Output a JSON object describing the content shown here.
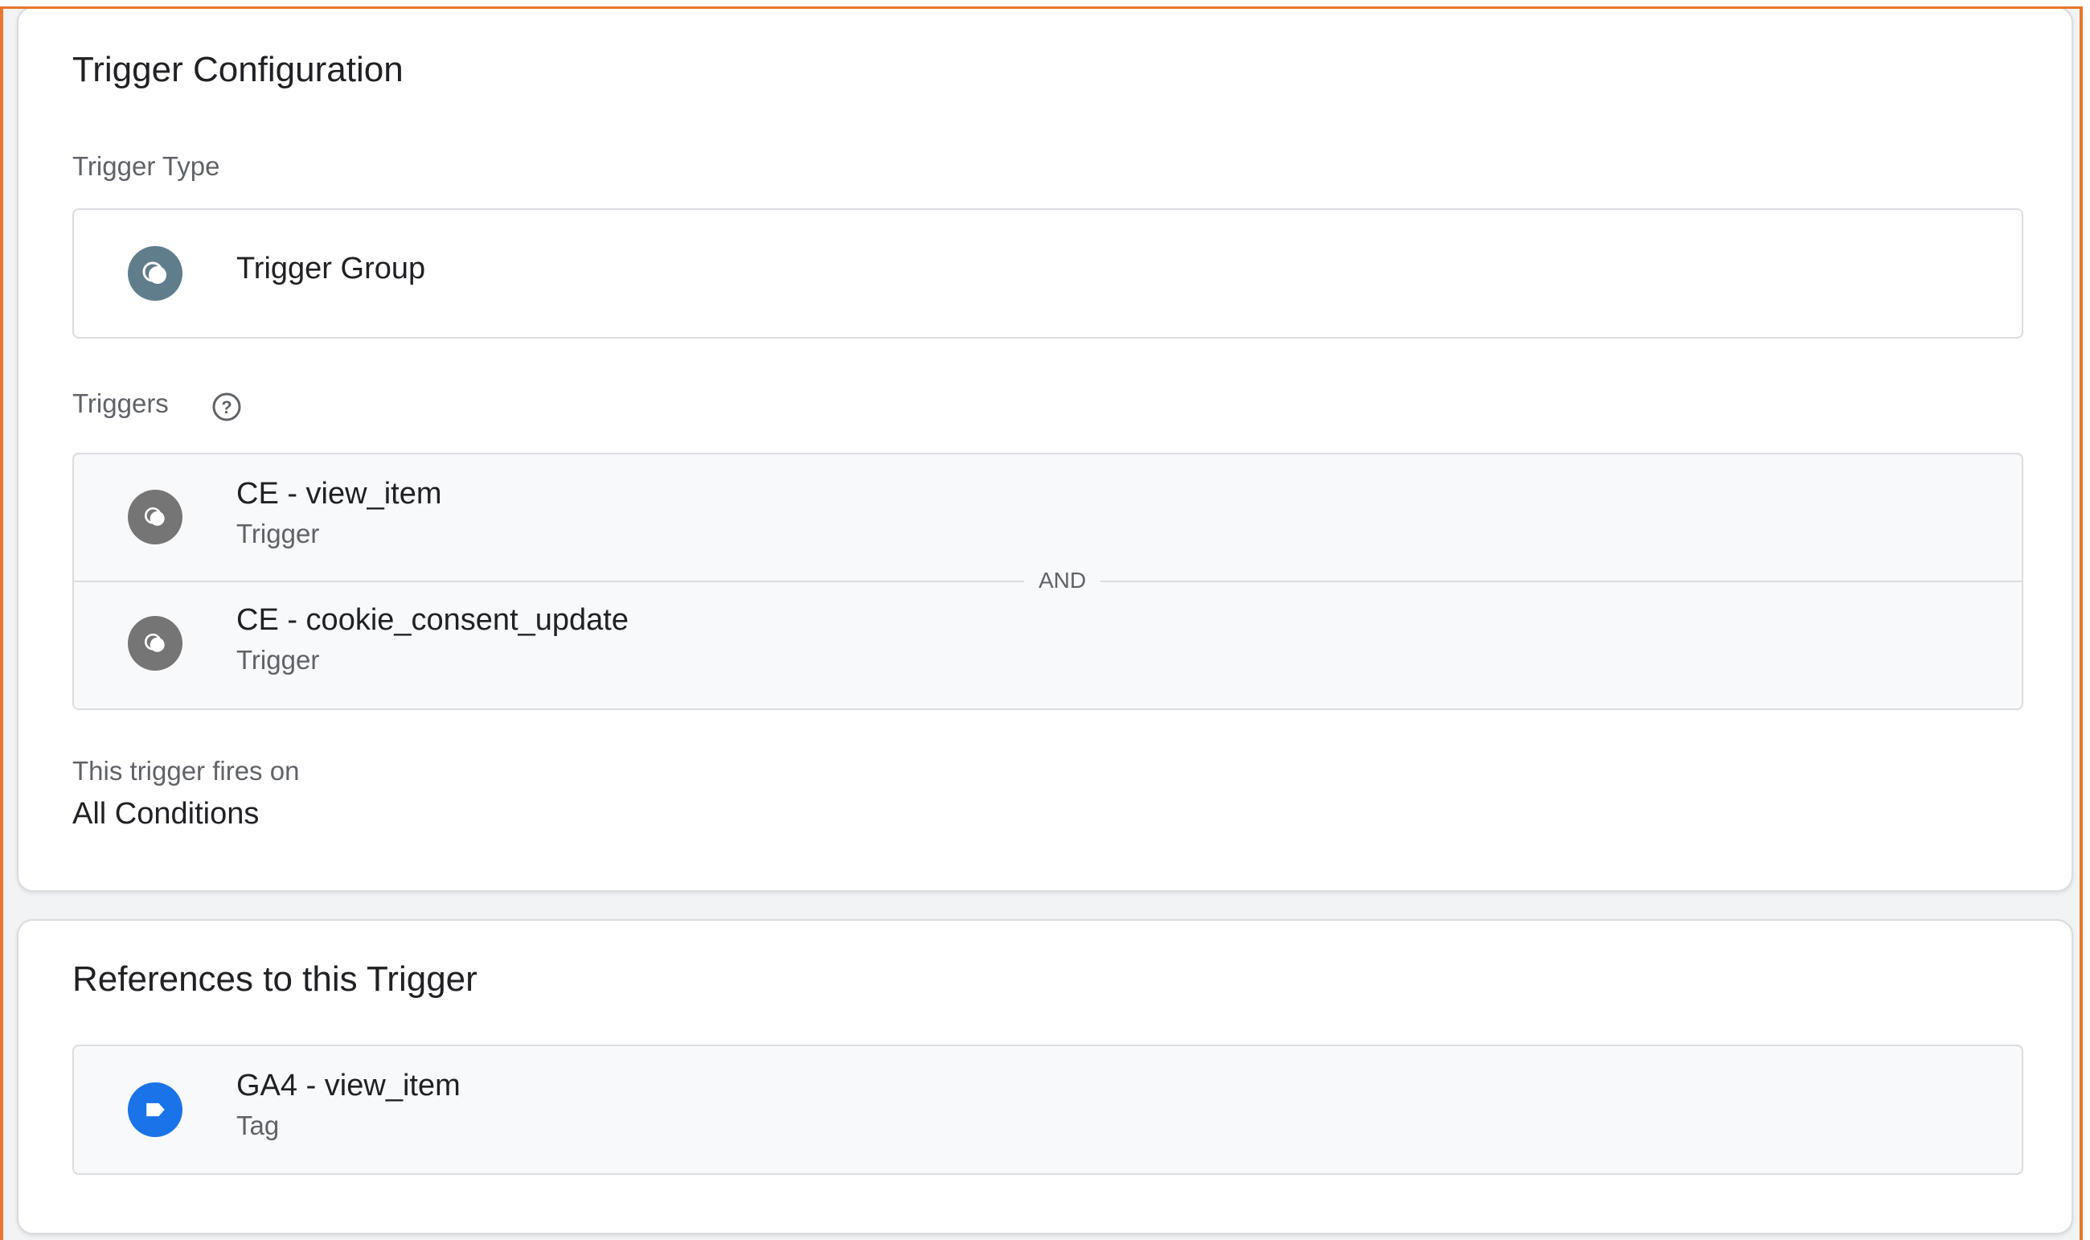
{
  "trigger_configuration": {
    "title": "Trigger Configuration",
    "trigger_type_label": "Trigger Type",
    "trigger_type": {
      "name": "Trigger Group",
      "icon": "trigger-group-icon"
    },
    "triggers_label": "Triggers",
    "triggers_help_icon": "help-icon",
    "triggers": [
      {
        "name": "CE - view_item",
        "kind": "Trigger",
        "icon": "trigger-icon"
      },
      {
        "name": "CE - cookie_consent_update",
        "kind": "Trigger",
        "icon": "trigger-icon"
      }
    ],
    "join_operator": "AND",
    "fires_on_label": "This trigger fires on",
    "fires_on_value": "All Conditions"
  },
  "references": {
    "title": "References to this Trigger",
    "items": [
      {
        "name": "GA4 - view_item",
        "kind": "Tag",
        "icon": "tag-icon"
      }
    ]
  },
  "colors": {
    "trigger_type_icon_bg": "#607d8b",
    "trigger_icon_bg": "#757575",
    "tag_icon_bg": "#1a73e8",
    "frame_accent": "#e8762c"
  }
}
